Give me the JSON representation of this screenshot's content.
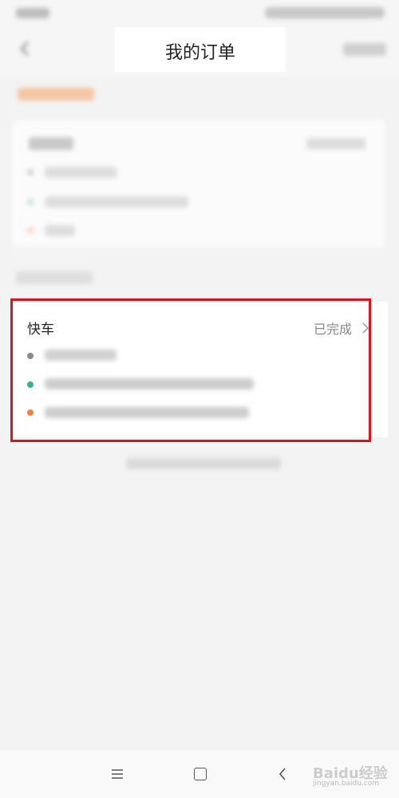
{
  "header": {
    "title": "我的订单"
  },
  "orders": [
    {
      "type": "快车",
      "status": "已完成"
    }
  ],
  "watermark": {
    "text": "Baidu经验",
    "sub": "jingyan.baidu.com"
  },
  "colors": {
    "highlight": "#d9141a",
    "start_dot": "#2fb592",
    "end_dot": "#f0833e",
    "time_dot": "#8a8a8a"
  },
  "icons": {
    "back": "chevron-left-icon",
    "status_arrow": "chevron-right-icon",
    "nav_menu": "menu-icon",
    "nav_home": "square-icon",
    "nav_back": "triangle-back-icon"
  }
}
